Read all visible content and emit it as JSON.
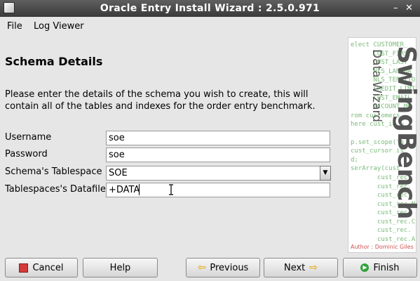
{
  "window": {
    "title": "Oracle Entry Install Wizard : 2.5.0.971",
    "minimize_glyph": "–",
    "close_glyph": "✕"
  },
  "menu": [
    "File",
    "Log Viewer"
  ],
  "page": {
    "heading": "Schema Details",
    "description": "Please enter the details of the schema you wish to create, this will contain all of the tables and indexes for the order entry benchmark."
  },
  "form": {
    "fields": [
      {
        "label": "Username",
        "value": "soe"
      },
      {
        "label": "Password",
        "value": "soe"
      },
      {
        "label": "Schema's Tablespace",
        "value": "SOE"
      },
      {
        "label": "Tablespaces's Datafile",
        "value": "+DATA"
      }
    ]
  },
  "sidebar": {
    "brand": "SwingBench",
    "subtitle": "Data Wizard",
    "author": "Author : Dominic Giles",
    "code_lines": [
      "elect CUSTOMER_",
      "      CUST_FIRST",
      "      CUST_LAST",
      "      NLS_LANGUA",
      "      NLS_TERRITO",
      "      CREDIT_LIMIT",
      "      CUST_EMAIL",
      "      ACCOUNT_MG",
      "rom customers",
      "here cust_id =",
      "",
      "p.set_scope(\"g",
      "cust_cursor is",
      "d;",
      "serArray(cust",
      "       cust_rec.",
      "       cust_rec.",
      "       cust_rec.",
      "       cust_rec.N",
      "       cust_rec.",
      "       cust_rec.C",
      "       cust_rec.",
      "       cust_rec.A"
    ]
  },
  "buttons": {
    "cancel": "Cancel",
    "help": "Help",
    "previous": "Previous",
    "next": "Next",
    "finish": "Finish"
  }
}
